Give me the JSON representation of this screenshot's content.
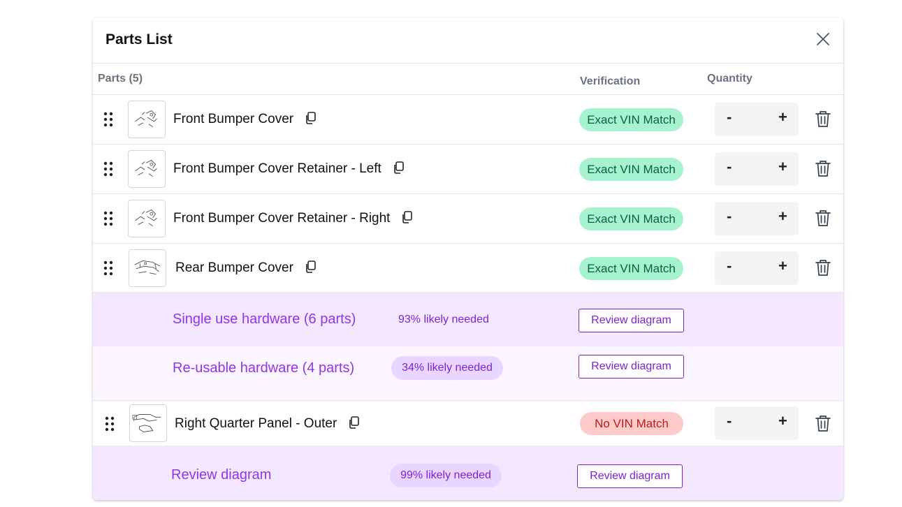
{
  "panel": {
    "title": "Parts List",
    "close_icon": "close-icon"
  },
  "columns": {
    "parts": "Parts (5)",
    "verification": "Verification",
    "quantity": "Quantity"
  },
  "parts": [
    {
      "name": "Front Bumper Cover",
      "verification": "Exact VIN Match",
      "status": "ok"
    },
    {
      "name": "Front Bumper Cover Retainer - Left",
      "verification": "Exact VIN Match",
      "status": "ok"
    },
    {
      "name": "Front Bumper Cover Retainer - Right",
      "verification": "Exact VIN Match",
      "status": "ok"
    },
    {
      "name": "Rear Bumper Cover",
      "verification": "Exact VIN Match",
      "status": "ok"
    },
    {
      "name": "Right Quarter Panel - Outer",
      "verification": "No VIN Match",
      "status": "bad"
    }
  ],
  "quantity": {
    "minus": "-",
    "plus": "+"
  },
  "hardware": [
    {
      "title": "Single use hardware (6 parts)",
      "probability": "93% likely needed",
      "button": "Review diagram"
    },
    {
      "title": "Re-usable hardware (4 parts)",
      "probability": "34% likely needed",
      "button": "Review diagram"
    },
    {
      "title": "Review diagram",
      "probability": "99% likely needed",
      "button": "Review diagram"
    }
  ],
  "colors": {
    "exact_match_bg": "#a7f3d0",
    "exact_match_text": "#065f46",
    "no_match_bg": "#fecaca",
    "no_match_text": "#b91c1c",
    "hardware_accent": "#9333ea",
    "hardware_bg_primary": "#f3e8ff",
    "hardware_bg_secondary": "#faf5ff"
  }
}
